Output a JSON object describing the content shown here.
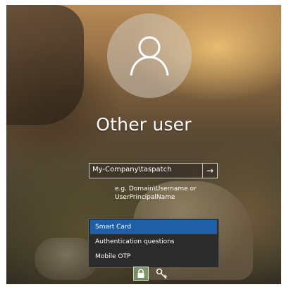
{
  "login": {
    "user_name": "Other user",
    "username_value": "My-Company\\taspatch",
    "hint": "e.g. Domain\\Username or UserPrincipalName"
  },
  "signin_options": [
    {
      "label": "Smart Card",
      "selected": true
    },
    {
      "label": "Authentication questions",
      "selected": false
    },
    {
      "label": "Mobile OTP",
      "selected": false
    }
  ],
  "icons": {
    "avatar": "user-icon",
    "submit": "arrow-right-icon",
    "tile_1": "lock-icon",
    "tile_2": "key-icon"
  },
  "colors": {
    "selected_option": "#1f5fa8",
    "menu_background": "#2b2b2b",
    "text": "#ffffff"
  }
}
